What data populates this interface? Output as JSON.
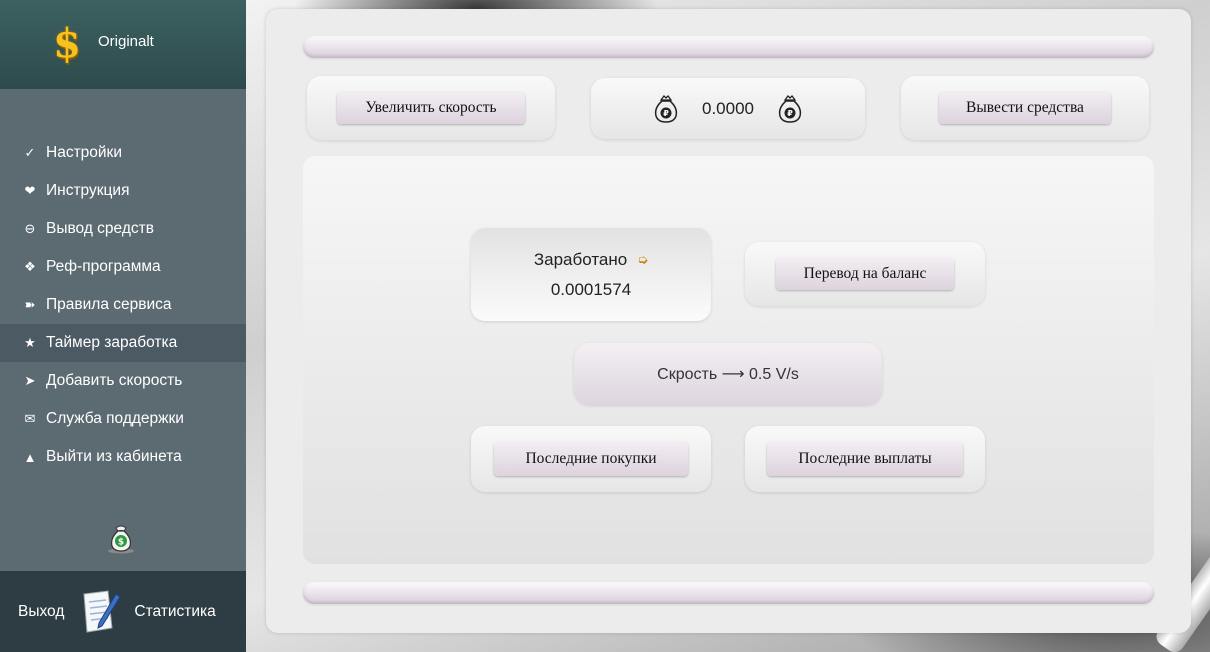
{
  "brand": {
    "logo_symbol": "$",
    "name": "Originalt"
  },
  "sidebar": {
    "items": [
      {
        "icon": "check-icon",
        "glyph": "✓",
        "label": "Настройки"
      },
      {
        "icon": "heart-icon",
        "glyph": "❤",
        "label": "Инструкция"
      },
      {
        "icon": "circle-minus-icon",
        "glyph": "⊖",
        "label": "Вывод средств"
      },
      {
        "icon": "diamond-icon",
        "glyph": "❖",
        "label": "Реф-программа"
      },
      {
        "icon": "arrow-right-icon",
        "glyph": "➽",
        "label": "Правила сервиса"
      },
      {
        "icon": "star-icon",
        "glyph": "★",
        "label": "Таймер заработка",
        "active": true
      },
      {
        "icon": "arrowhead-icon",
        "glyph": "➤",
        "label": "Добавить скорость"
      },
      {
        "icon": "envelope-icon",
        "glyph": "✉",
        "label": "Служба поддержки"
      },
      {
        "icon": "triangle-up-icon",
        "glyph": "▲",
        "label": "Выйти из кабинета"
      }
    ],
    "footer": {
      "exit_label": "Выход",
      "stats_label": "Статистика"
    }
  },
  "toolbar": {
    "speed_up_label": "Увеличить скорость",
    "balance_value": "0.0000",
    "withdraw_label": "Вывести средства"
  },
  "main": {
    "earned_label": "Заработано",
    "earned_arrow": "➭",
    "earned_value": "0.0001574",
    "transfer_label": "Перевод на баланс",
    "speed_text": "Скрость ⟶  0.5  V/s",
    "recent_purchases_label": "Последние покупки",
    "recent_payouts_label": "Последние выплаты"
  },
  "colors": {
    "sidebar_bg": "#5c6b72",
    "sidebar_active": "#4c5a63",
    "brand_bg": "#3c6160",
    "footer_bg": "#2e3d44",
    "accent_gold": "#f7c21e",
    "button_tint": "#ddd3de"
  }
}
